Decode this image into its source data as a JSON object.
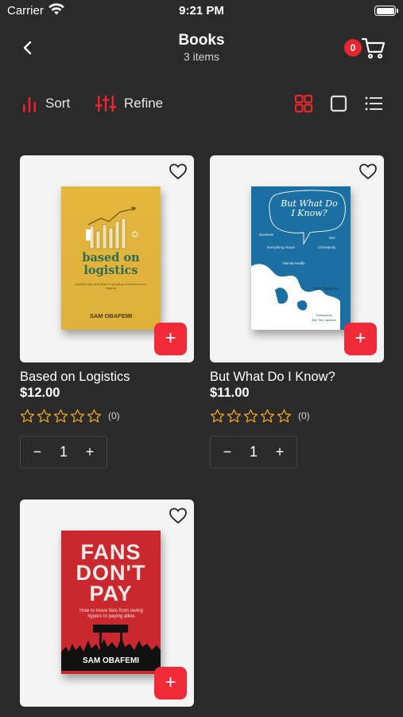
{
  "status": {
    "carrier": "Carrier",
    "time": "9:21 PM"
  },
  "header": {
    "title": "Books",
    "subtitle": "3 items",
    "cart_count": "0"
  },
  "toolbar": {
    "sort_label": "Sort",
    "refine_label": "Refine",
    "active_view": "grid"
  },
  "colors": {
    "accent": "#e8262f",
    "background": "#2a2a2a",
    "star": "#f5a623"
  },
  "products": [
    {
      "title": "Based on Logistics",
      "price": "$12.00",
      "rating_count": "(0)",
      "quantity": "1",
      "cover": {
        "title": "based on logistics",
        "subtitle": "practical tips and tricks to growing a business from Nigeria",
        "author": "SAM OBAFEMI"
      }
    },
    {
      "title": "But What Do I Know?",
      "price": "$11.00",
      "rating_count": "(0)",
      "quantity": "1",
      "cover": {
        "title": "But What Do I Know?",
        "words": [
          "Business",
          "Sex",
          "Everything Above",
          "Christianity",
          "Mental Health"
        ],
        "author": "Sam Obafemi",
        "foreword_label": "Foreword by",
        "foreword": "Seyi 'Tinz' Lapulusu"
      }
    },
    {
      "title": "",
      "price": "",
      "rating_count": "",
      "quantity": "",
      "cover": {
        "title": "FANS DON'T PAY",
        "subtitle": "How to move fans from raving hypers to paying allies",
        "author": "SAM OBAFEMI"
      }
    }
  ]
}
